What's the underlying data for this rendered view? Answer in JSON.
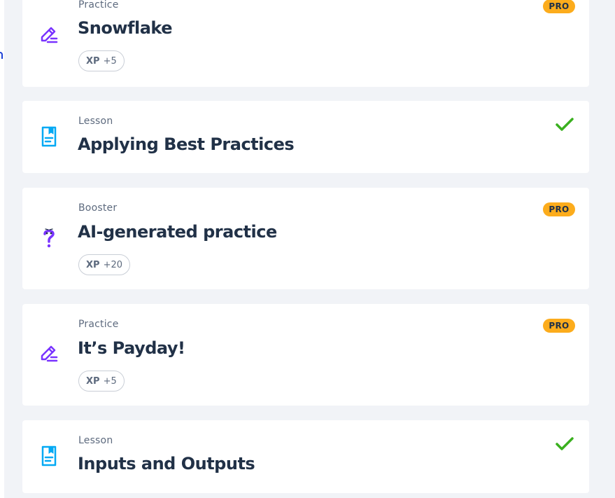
{
  "items": [
    {
      "type": "Practice",
      "title": "Snowflake",
      "xp_label": "XP",
      "xp_value": "+5",
      "badge": "PRO",
      "icon": "pencil-icon"
    },
    {
      "type": "Lesson",
      "title": "Applying Best Practices",
      "status": "completed",
      "icon": "lesson-document-icon"
    },
    {
      "type": "Booster",
      "title": "AI-generated practice",
      "xp_label": "XP",
      "xp_value": "+20",
      "badge": "PRO",
      "icon": "question-mark-icon"
    },
    {
      "type": "Practice",
      "title": "It’s Payday!",
      "xp_label": "XP",
      "xp_value": "+5",
      "badge": "PRO",
      "icon": "pencil-icon"
    },
    {
      "type": "Lesson",
      "title": "Inputs and Outputs",
      "status": "completed",
      "icon": "lesson-document-icon"
    }
  ],
  "colors": {
    "background": "#f1f3f7",
    "card": "#ffffff",
    "title_text": "#213147",
    "muted_text": "#5d6a7e",
    "pro_badge": "#fcac1c",
    "check": "#3ab01f",
    "lesson_icon": "#03a9f4",
    "practice_icon": "#7933ff"
  }
}
